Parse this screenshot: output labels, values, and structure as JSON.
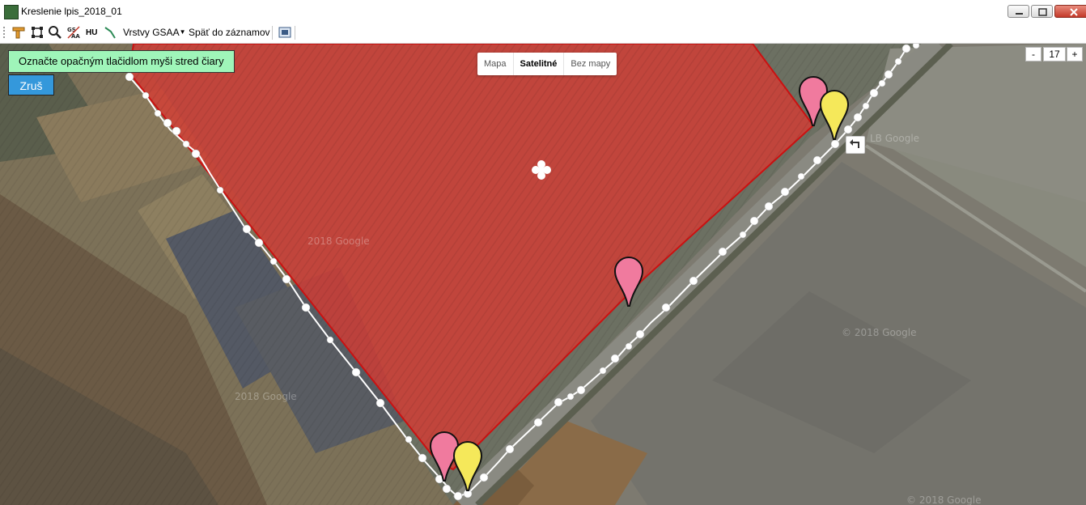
{
  "window": {
    "title": "Kreslenie lpis_2018_01"
  },
  "toolbar": {
    "hu_label": "HU",
    "layers_label": "Vrstvy GSAA",
    "back_label": "Späť do záznamov"
  },
  "map": {
    "type_buttons": [
      "Mapa",
      "Satelitné",
      "Bez mapy"
    ],
    "active_type": "Satelitné",
    "hint": "Označte opačným tlačidlom myši stred čiary",
    "cancel_label": "Zruš",
    "zoom_minus": "-",
    "zoom_level": "17",
    "zoom_plus": "+",
    "watermark": "© 2018 Google"
  },
  "colors": {
    "polygon_fill": "#d93a32",
    "polygon_stroke": "#cc1111",
    "hint_bg": "#9ff5b9",
    "cancel_bg": "#3498db",
    "marker_pink": "#f07a9e",
    "marker_yellow": "#f5e85a"
  }
}
